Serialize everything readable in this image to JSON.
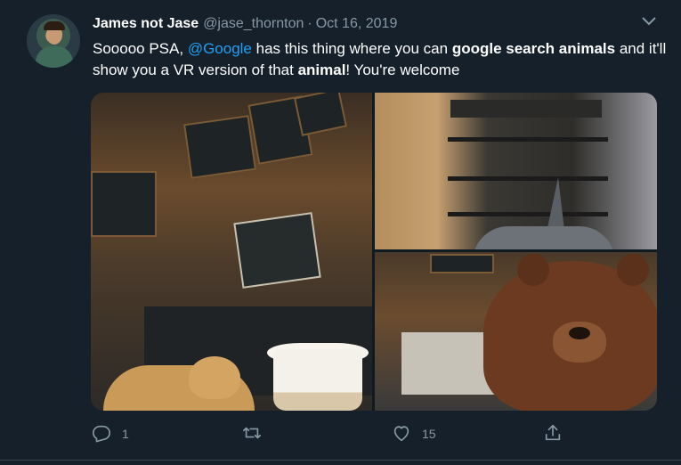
{
  "tweet": {
    "author_name": "James not Jase",
    "handle": "@jase_thornton",
    "separator": "·",
    "date": "Oct 16, 2019",
    "text": {
      "p1": "Sooooo PSA, ",
      "mention": "@Google",
      "p2": " has this thing where you can ",
      "bold1": "google search animals",
      "p3": " and it'll show you a VR version of that ",
      "bold2": "animal",
      "p4": "! You're welcome"
    },
    "colors": {
      "background": "#15202b",
      "secondary_text": "#8899a6",
      "link": "#1da1f2"
    }
  },
  "media": {
    "photos": [
      "photo-cafe-dog",
      "photo-shelves-shark",
      "photo-cafe-bear"
    ]
  },
  "actions": {
    "reply_count": "1",
    "retweet_count": "",
    "like_count": "15",
    "icons": [
      "reply-icon",
      "retweet-icon",
      "like-icon",
      "share-icon"
    ]
  }
}
